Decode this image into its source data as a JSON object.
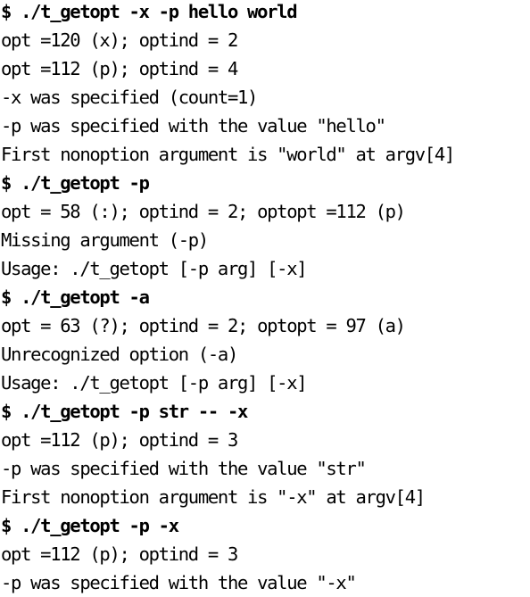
{
  "terminal": {
    "lines": [
      {
        "kind": "command",
        "text": "$ ./t_getopt -x -p hello world"
      },
      {
        "kind": "output",
        "text": "opt =120 (x); optind = 2"
      },
      {
        "kind": "output",
        "text": "opt =112 (p); optind = 4"
      },
      {
        "kind": "output",
        "text": "-x was specified (count=1)"
      },
      {
        "kind": "output",
        "text": "-p was specified with the value \"hello\""
      },
      {
        "kind": "output",
        "text": "First nonoption argument is \"world\" at argv[4]"
      },
      {
        "kind": "command",
        "text": "$ ./t_getopt -p"
      },
      {
        "kind": "output",
        "text": "opt = 58 (:); optind = 2; optopt =112 (p)"
      },
      {
        "kind": "output",
        "text": "Missing argument (-p)"
      },
      {
        "kind": "output",
        "text": "Usage: ./t_getopt [-p arg] [-x]"
      },
      {
        "kind": "command",
        "text": "$ ./t_getopt -a"
      },
      {
        "kind": "output",
        "text": "opt = 63 (?); optind = 2; optopt = 97 (a)"
      },
      {
        "kind": "output",
        "text": "Unrecognized option (-a)"
      },
      {
        "kind": "output",
        "text": "Usage: ./t_getopt [-p arg] [-x]"
      },
      {
        "kind": "command",
        "text": "$ ./t_getopt -p str -- -x"
      },
      {
        "kind": "output",
        "text": "opt =112 (p); optind = 3"
      },
      {
        "kind": "output",
        "text": "-p was specified with the value \"str\""
      },
      {
        "kind": "output",
        "text": "First nonoption argument is \"-x\" at argv[4]"
      },
      {
        "kind": "command",
        "text": "$ ./t_getopt -p -x"
      },
      {
        "kind": "output",
        "text": "opt =112 (p); optind = 3"
      },
      {
        "kind": "output",
        "text": "-p was specified with the value \"-x\""
      }
    ]
  }
}
